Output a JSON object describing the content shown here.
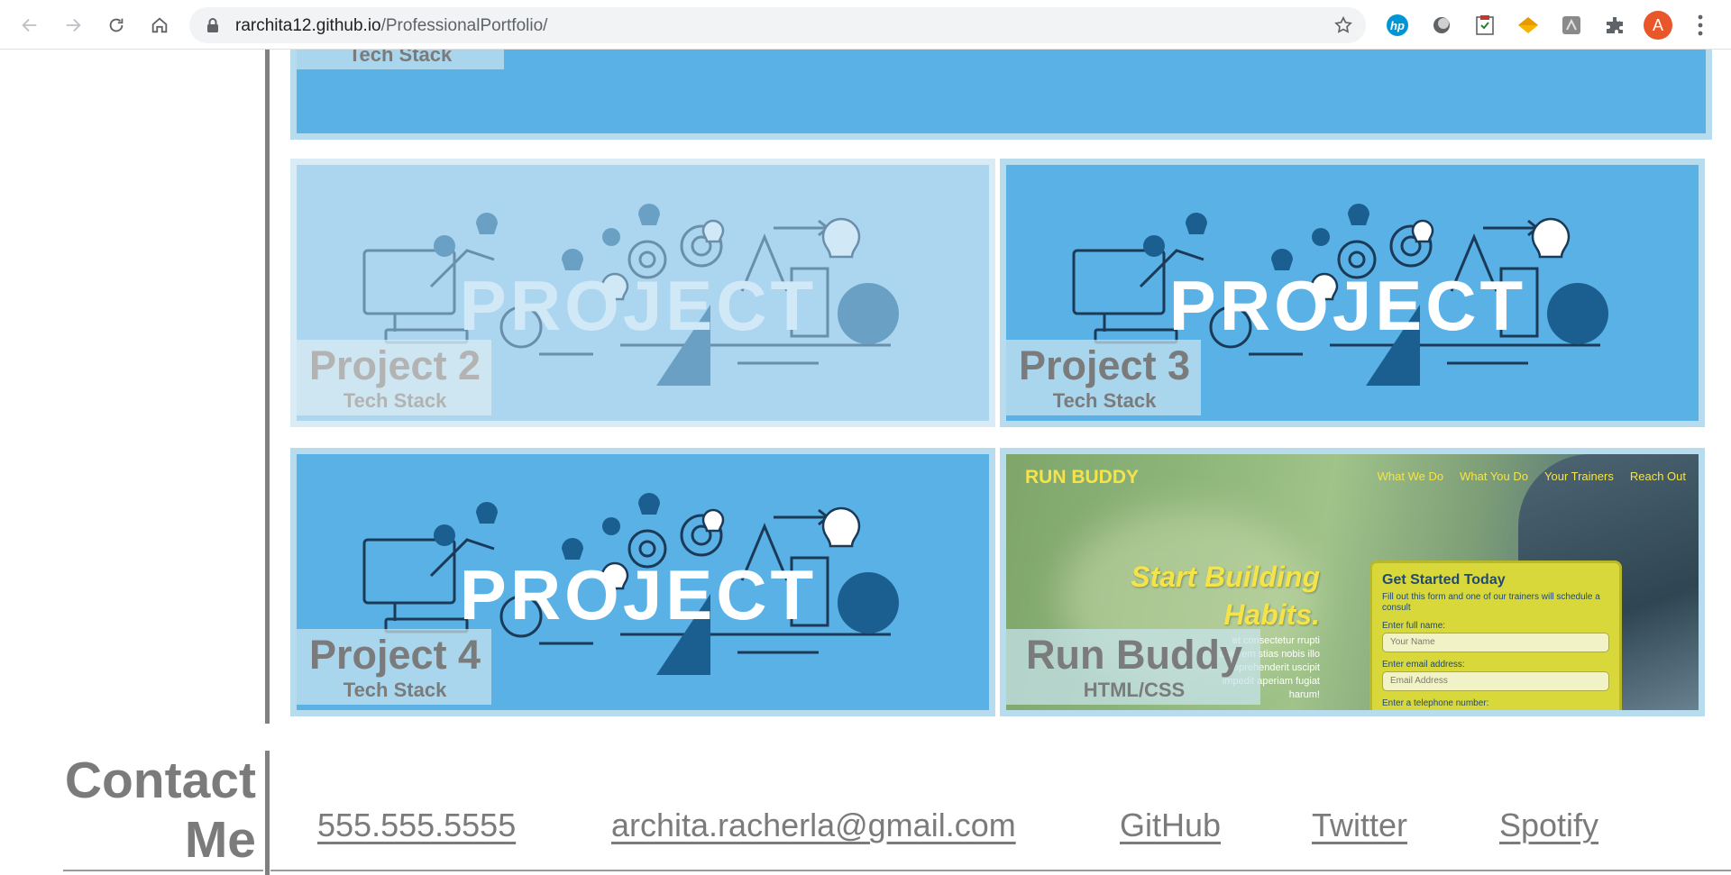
{
  "browser": {
    "url_domain": "rarchita12.github.io",
    "url_path": "/ProfessionalPortfolio/",
    "avatar_letter": "A",
    "extensions": [
      "hp-icon",
      "circle-extension-icon",
      "clipboard-extension-icon",
      "diamond-extension-icon",
      "puzzle-app-icon",
      "extensions-icon"
    ]
  },
  "projects": {
    "top_partial": {
      "subtitle": "Tech Stack"
    },
    "items": [
      {
        "title": "Project 2",
        "subtitle": "Tech Stack",
        "art_word": "PROJECT",
        "state": "faded"
      },
      {
        "title": "Project 3",
        "subtitle": "Tech Stack",
        "art_word": "PROJECT",
        "state": "normal"
      },
      {
        "title": "Project 4",
        "subtitle": "Tech Stack",
        "art_word": "PROJECT",
        "state": "normal"
      },
      {
        "title": "Run Buddy",
        "subtitle": "HTML/CSS",
        "state": "normal"
      }
    ]
  },
  "run_buddy": {
    "brand": "RUN BUDDY",
    "nav": [
      "What We Do",
      "What You Do",
      "Your Trainers",
      "Reach Out"
    ],
    "hero_line1": "Start Building",
    "hero_line2": "Habits.",
    "lorem": "et consectetur rrupti dolorem stias nobis illo reprehenderit uscipit impedit aperiam fugiat harum!",
    "form_title": "Get Started Today",
    "form_sub": "Fill out this form and one of our trainers will schedule a consult",
    "label_name": "Enter full name:",
    "placeholder_name": "Your Name",
    "label_email": "Enter email address:",
    "placeholder_email": "Email Address",
    "label_phone": "Enter a telephone number:"
  },
  "contact": {
    "title_line1": "Contact",
    "title_line2": "Me",
    "phone": "555.555.5555",
    "email": "archita.racherla@gmail.com",
    "github": "GitHub",
    "twitter": "Twitter",
    "spotify": "Spotify"
  },
  "colors": {
    "tile_blue": "#5ab1e6",
    "tile_border": "#b7dcee",
    "caption_text": "#7b7b7b",
    "runbuddy_yellow": "#f5e34a"
  }
}
